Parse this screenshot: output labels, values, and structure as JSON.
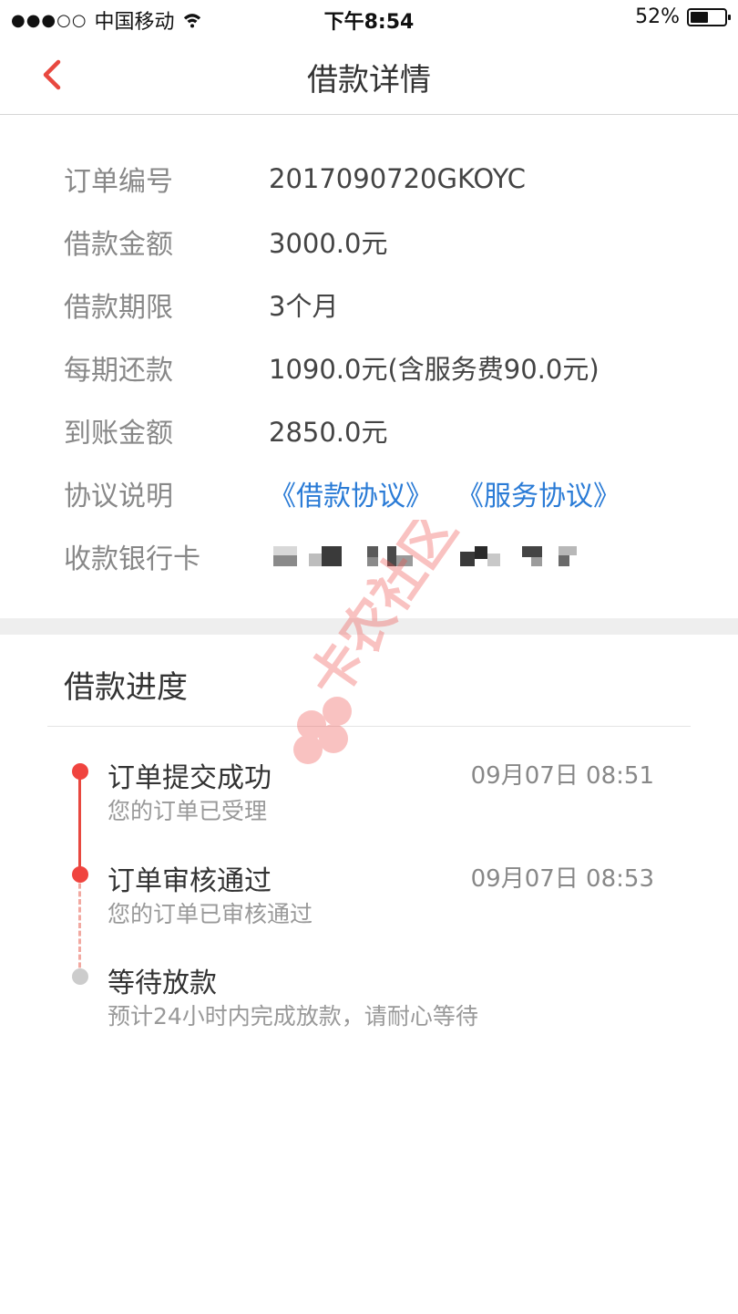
{
  "status_bar": {
    "signal": "●●●○○",
    "carrier": "中国移动",
    "time": "下午8:54",
    "battery_percent": "52%",
    "battery_level": 0.52
  },
  "header": {
    "title": "借款详情",
    "back_icon": "chevron-left-icon",
    "accent_color": "#e8483f"
  },
  "details": {
    "order_no": {
      "label": "订单编号",
      "value": "2017090720GKOYC"
    },
    "amount": {
      "label": "借款金额",
      "value": "3000.0元"
    },
    "term": {
      "label": "借款期限",
      "value": "3个月"
    },
    "installment": {
      "label": "每期还款",
      "value": "1090.0元(含服务费90.0元)"
    },
    "received": {
      "label": "到账金额",
      "value": "2850.0元"
    },
    "agreement": {
      "label": "协议说明",
      "loan_link": "《借款协议》",
      "service_link": "《服务协议》",
      "link_color": "#2a7bd6"
    },
    "bank_card": {
      "label": "收款银行卡"
    }
  },
  "progress": {
    "title": "借款进度",
    "steps": [
      {
        "title": "订单提交成功",
        "desc": "您的订单已受理",
        "time": "09月07日 08:51",
        "status": "done"
      },
      {
        "title": "订单审核通过",
        "desc": "您的订单已审核通过",
        "time": "09月07日 08:53",
        "status": "done"
      },
      {
        "title": "等待放款",
        "desc": "预计24小时内完成放款，请耐心等待",
        "time": "",
        "status": "pending"
      }
    ]
  },
  "watermark": {
    "text": "卡农社区"
  }
}
